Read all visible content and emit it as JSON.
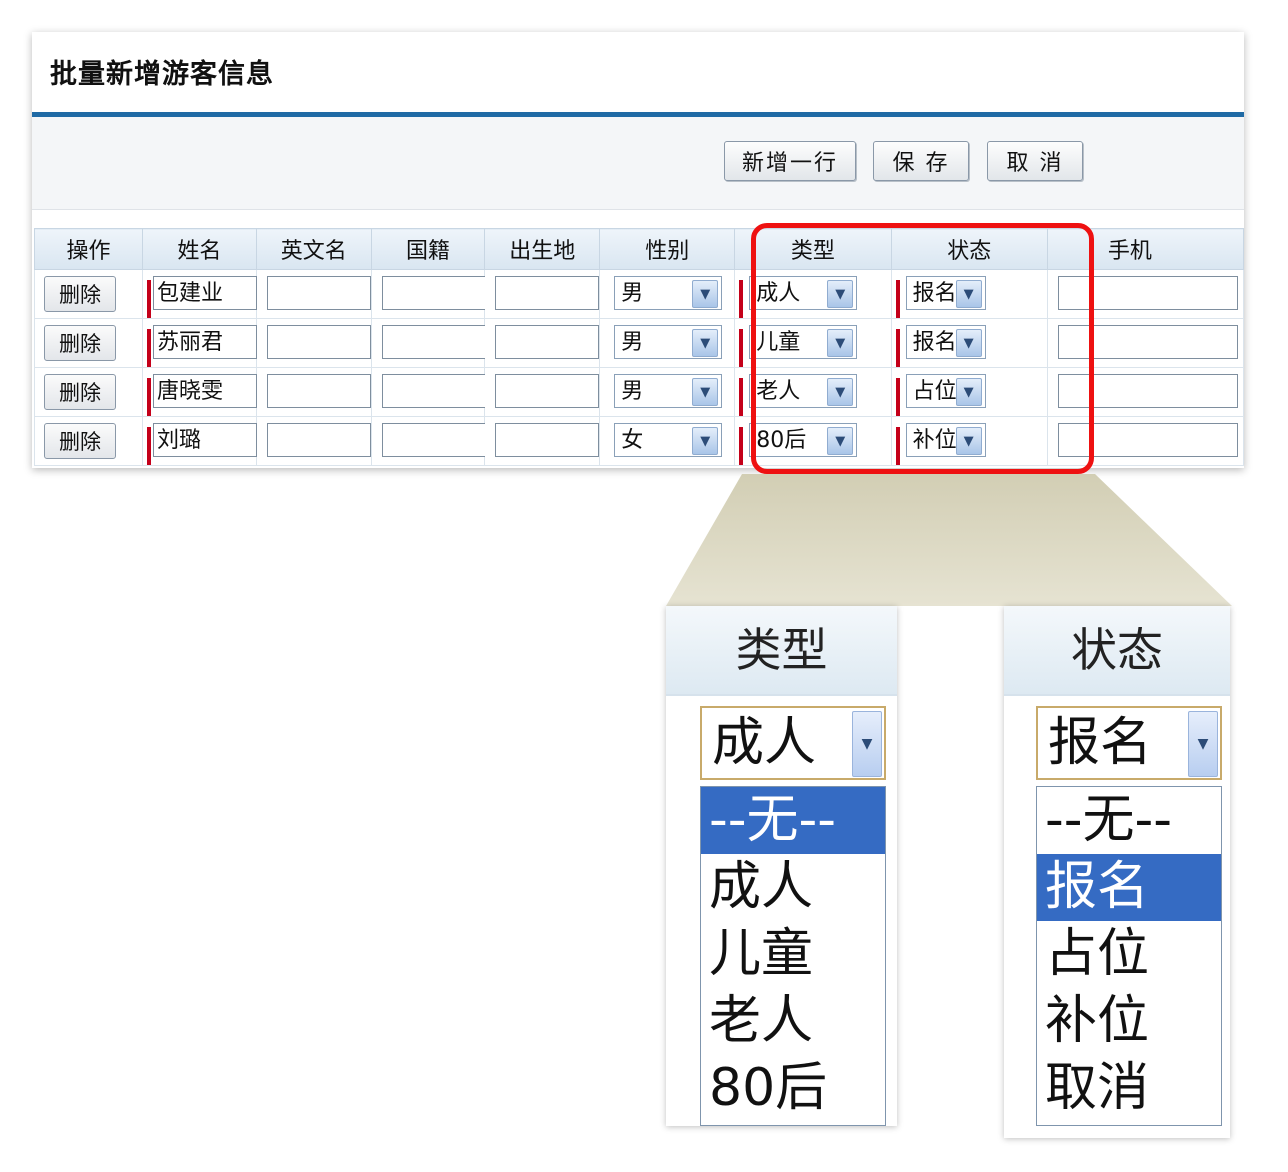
{
  "form": {
    "title": "批量新增游客信息",
    "buttons": {
      "add_row": "新增一行",
      "save": "保 存",
      "cancel": "取 消"
    },
    "columns": {
      "op": "操作",
      "name": "姓名",
      "en_name": "英文名",
      "nationality": "国籍",
      "birthplace": "出生地",
      "gender": "性别",
      "type": "类型",
      "status": "状态",
      "mobile": "手机"
    },
    "delete_label": "删除",
    "rows": [
      {
        "name": "包建业",
        "en_name": "",
        "nationality": "",
        "birthplace": "",
        "gender": "男",
        "type": "成人",
        "status": "报名",
        "mobile": ""
      },
      {
        "name": "苏丽君",
        "en_name": "",
        "nationality": "",
        "birthplace": "",
        "gender": "男",
        "type": "儿童",
        "status": "报名",
        "mobile": ""
      },
      {
        "name": "唐晓雯",
        "en_name": "",
        "nationality": "",
        "birthplace": "",
        "gender": "男",
        "type": "老人",
        "status": "占位",
        "mobile": ""
      },
      {
        "name": "刘璐",
        "en_name": "",
        "nationality": "",
        "birthplace": "",
        "gender": "女",
        "type": "80后",
        "status": "补位",
        "mobile": ""
      }
    ]
  },
  "zoom": {
    "type": {
      "header": "类型",
      "selected": "成人",
      "options": [
        "--无--",
        "成人",
        "儿童",
        "老人",
        "80后"
      ],
      "highlighted": 0
    },
    "status": {
      "header": "状态",
      "selected": "报名",
      "options": [
        "--无--",
        "报名",
        "占位",
        "补位",
        "取消"
      ],
      "highlighted": 1
    }
  },
  "colors": {
    "required_marker": "#c4001a",
    "highlight_border": "#ee1111",
    "option_selected": "#356bc3",
    "title_rule": "#1f6aa5"
  },
  "icons": {
    "select_arrow": "chevron-down-icon"
  }
}
